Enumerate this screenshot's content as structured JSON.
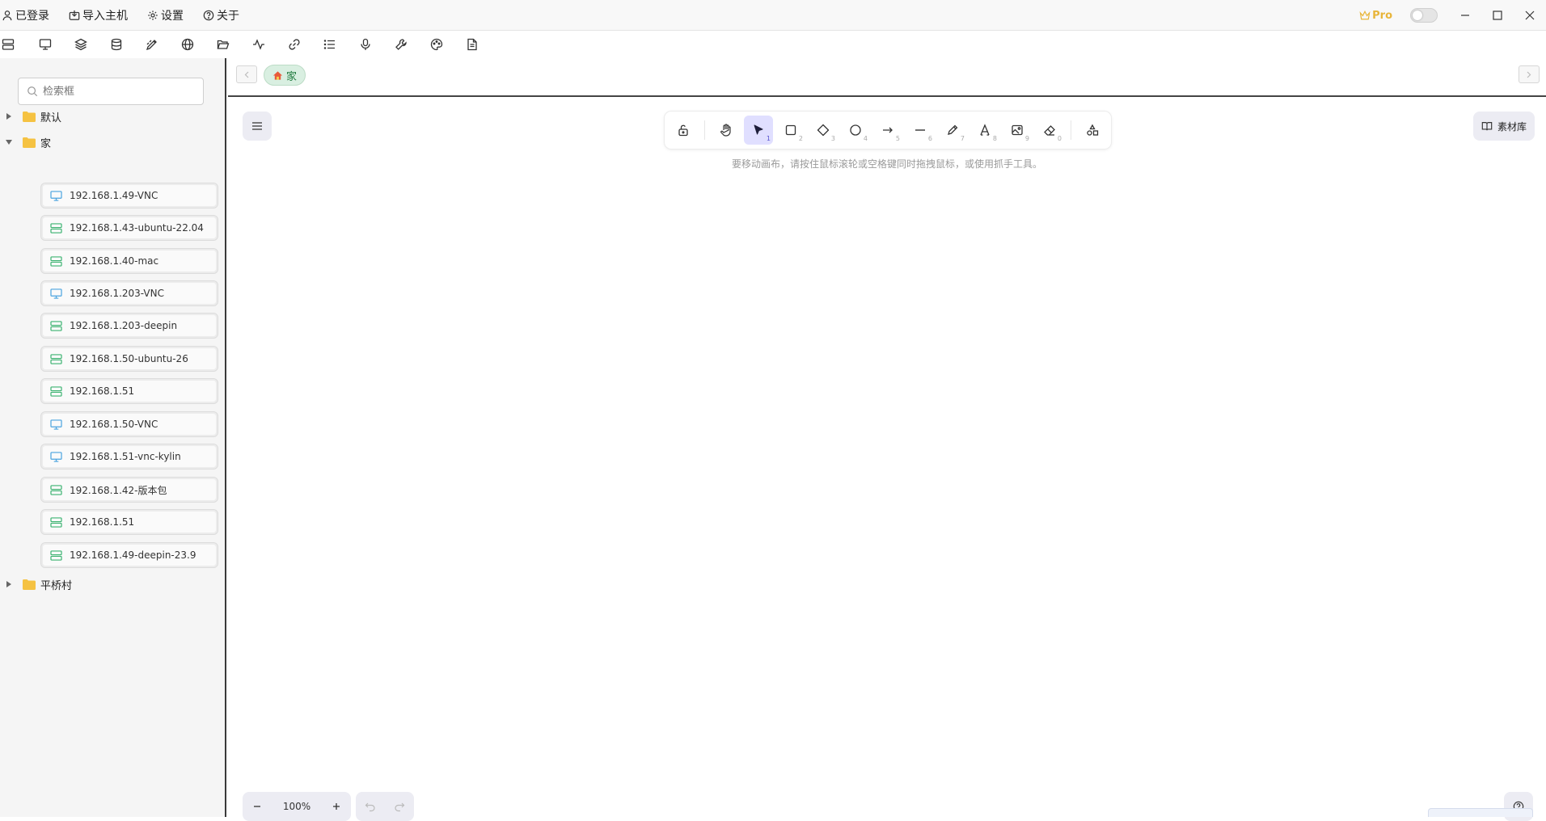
{
  "titlebar": {
    "menu": [
      {
        "label": "已登录",
        "icon": "user-icon"
      },
      {
        "label": "导入主机",
        "icon": "import-icon"
      },
      {
        "label": "设置",
        "icon": "gear-icon"
      },
      {
        "label": "关于",
        "icon": "help-circle-icon"
      }
    ],
    "pro_label": "Pro",
    "pro_color": "#e8b53a"
  },
  "iconbar": [
    "server-icon",
    "monitor-icon",
    "layers-icon",
    "database-icon",
    "pen-tool-icon",
    "globe-icon",
    "folder-open-icon",
    "activity-icon",
    "link-icon",
    "list-icon",
    "mic-icon",
    "wrench-icon",
    "palette-icon",
    "file-icon"
  ],
  "sidebar": {
    "search_placeholder": "检索框",
    "groups": [
      {
        "label": "默认",
        "expanded": false
      },
      {
        "label": "家",
        "expanded": true
      },
      {
        "label": "平桥村",
        "expanded": false
      }
    ],
    "hosts": [
      {
        "label": "192.168.1.49-VNC",
        "type": "vnc"
      },
      {
        "label": "192.168.1.43-ubuntu-22.04",
        "type": "server"
      },
      {
        "label": "192.168.1.40-mac",
        "type": "server"
      },
      {
        "label": "192.168.1.203-VNC",
        "type": "vnc"
      },
      {
        "label": "192.168.1.203-deepin",
        "type": "server"
      },
      {
        "label": "192.168.1.50-ubuntu-26",
        "type": "server"
      },
      {
        "label": "192.168.1.51",
        "type": "server"
      },
      {
        "label": "192.168.1.50-VNC",
        "type": "vnc"
      },
      {
        "label": "192.168.1.51-vnc-kylin",
        "type": "vnc"
      },
      {
        "label": "192.168.1.42-版本包",
        "type": "server"
      },
      {
        "label": "192.168.1.51",
        "type": "server"
      },
      {
        "label": "192.168.1.49-deepin-23.9",
        "type": "server"
      }
    ],
    "colors": {
      "vnc": "#4aa3df",
      "server": "#3cb371",
      "folder": "#f5c242"
    }
  },
  "main": {
    "tab_label": "家",
    "tab_color": "#1f7a3e",
    "tools": [
      {
        "name": "lock",
        "num": ""
      },
      {
        "name": "hand",
        "num": ""
      },
      {
        "name": "select",
        "num": "1"
      },
      {
        "name": "rectangle",
        "num": "2"
      },
      {
        "name": "diamond",
        "num": "3"
      },
      {
        "name": "ellipse",
        "num": "4"
      },
      {
        "name": "arrow",
        "num": "5"
      },
      {
        "name": "line",
        "num": "6"
      },
      {
        "name": "draw",
        "num": "7"
      },
      {
        "name": "text",
        "num": "8"
      },
      {
        "name": "image",
        "num": "9"
      },
      {
        "name": "eraser",
        "num": "0"
      },
      {
        "name": "extra-tools",
        "num": ""
      }
    ],
    "active_tool": "select",
    "accent_color": "#5b57d1",
    "hint": "要移动画布，请按住鼠标滚轮或空格键同时拖拽鼠标，或使用抓手工具。",
    "library_label": "素材库",
    "zoom": "100%"
  }
}
